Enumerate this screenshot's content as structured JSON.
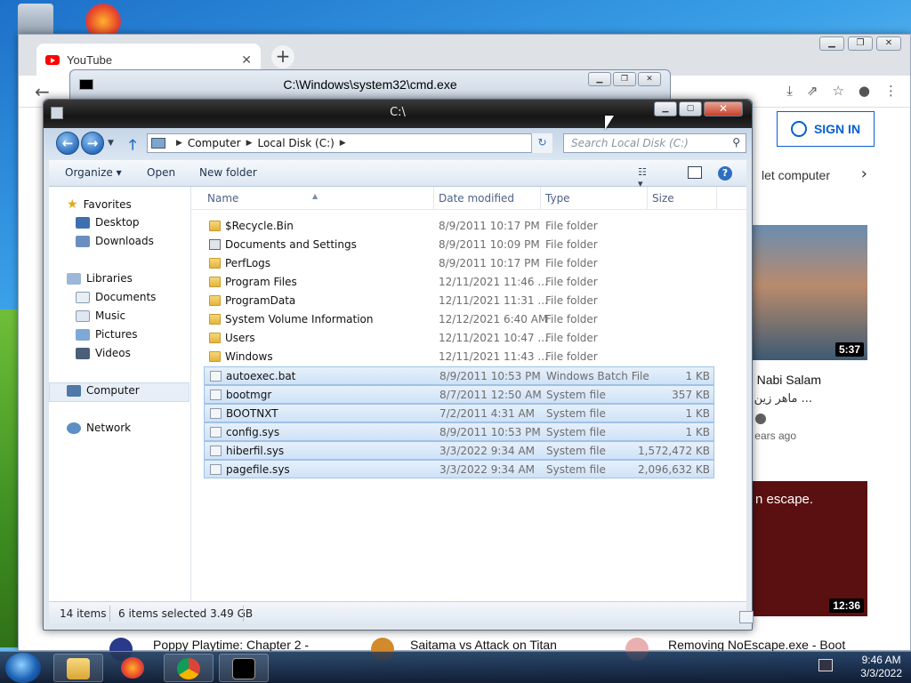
{
  "chrome": {
    "tab_title": "YouTube",
    "tab_close": "✕",
    "new_tab": "+",
    "sign_in": "SIGN IN",
    "chip_text": "let computer",
    "video1": {
      "title": "Nabi Salam",
      "subtitle": "ماهر زين - يا نبي ...",
      "meta": "ears ago",
      "duration": "5:37"
    },
    "video2": {
      "thumb_text": "n escape.",
      "duration": "12:36"
    },
    "bottom_titles": [
      "Poppy Playtime: Chapter 2 -",
      "Saitama vs Attack on Titan",
      "Removing NoEscape.exe - Boot"
    ]
  },
  "cmd": {
    "title": "C:\\Windows\\system32\\cmd.exe"
  },
  "explorer": {
    "title": "C:\\",
    "address": {
      "parts": [
        "Computer",
        "Local Disk (C:)"
      ]
    },
    "search_placeholder": "Search Local Disk (C:)",
    "toolbar": {
      "organize": "Organize ▾",
      "open": "Open",
      "new_folder": "New folder"
    },
    "nav": {
      "favorites": "Favorites",
      "desktop": "Desktop",
      "downloads": "Downloads",
      "libraries": "Libraries",
      "documents": "Documents",
      "music": "Music",
      "pictures": "Pictures",
      "videos": "Videos",
      "computer": "Computer",
      "network": "Network"
    },
    "columns": {
      "name": "Name",
      "date": "Date modified",
      "type": "Type",
      "size": "Size"
    },
    "files": [
      {
        "name": "$Recycle.Bin",
        "date": "8/9/2011 10:17 PM",
        "type": "File folder",
        "size": "",
        "icon": "folder",
        "selected": false
      },
      {
        "name": "Documents and Settings",
        "date": "8/9/2011 10:09 PM",
        "type": "File folder",
        "size": "",
        "icon": "shortcut",
        "selected": false
      },
      {
        "name": "PerfLogs",
        "date": "8/9/2011 10:17 PM",
        "type": "File folder",
        "size": "",
        "icon": "folder",
        "selected": false
      },
      {
        "name": "Program Files",
        "date": "12/11/2021 11:46 ...",
        "type": "File folder",
        "size": "",
        "icon": "folder",
        "selected": false
      },
      {
        "name": "ProgramData",
        "date": "12/11/2021 11:31 ...",
        "type": "File folder",
        "size": "",
        "icon": "folder",
        "selected": false
      },
      {
        "name": "System Volume Information",
        "date": "12/12/2021 6:40 AM",
        "type": "File folder",
        "size": "",
        "icon": "folder",
        "selected": false
      },
      {
        "name": "Users",
        "date": "12/11/2021 10:47 ...",
        "type": "File folder",
        "size": "",
        "icon": "folder",
        "selected": false
      },
      {
        "name": "Windows",
        "date": "12/11/2021 11:43 ...",
        "type": "File folder",
        "size": "",
        "icon": "folder",
        "selected": false
      },
      {
        "name": "autoexec.bat",
        "date": "8/9/2011 10:53 PM",
        "type": "Windows Batch File",
        "size": "1 KB",
        "icon": "file",
        "selected": true
      },
      {
        "name": "bootmgr",
        "date": "8/7/2011 12:50 AM",
        "type": "System file",
        "size": "357 KB",
        "icon": "file",
        "selected": true
      },
      {
        "name": "BOOTNXT",
        "date": "7/2/2011 4:31 AM",
        "type": "System file",
        "size": "1 KB",
        "icon": "file",
        "selected": true
      },
      {
        "name": "config.sys",
        "date": "8/9/2011 10:53 PM",
        "type": "System file",
        "size": "1 KB",
        "icon": "file",
        "selected": true
      },
      {
        "name": "hiberfil.sys",
        "date": "3/3/2022 9:34 AM",
        "type": "System file",
        "size": "1,572,472 KB",
        "icon": "file",
        "selected": true
      },
      {
        "name": "pagefile.sys",
        "date": "3/3/2022 9:34 AM",
        "type": "System file",
        "size": "2,096,632 KB",
        "icon": "file",
        "selected": true
      }
    ],
    "status": {
      "count": "14 items",
      "selected": "6 items selected  3.49 GB"
    }
  },
  "taskbar": {
    "time": "9:46 AM",
    "date": "3/3/2022"
  },
  "colors": {
    "selection": "#cfe2f7",
    "accent": "#065fd4",
    "close": "#c7402b"
  }
}
